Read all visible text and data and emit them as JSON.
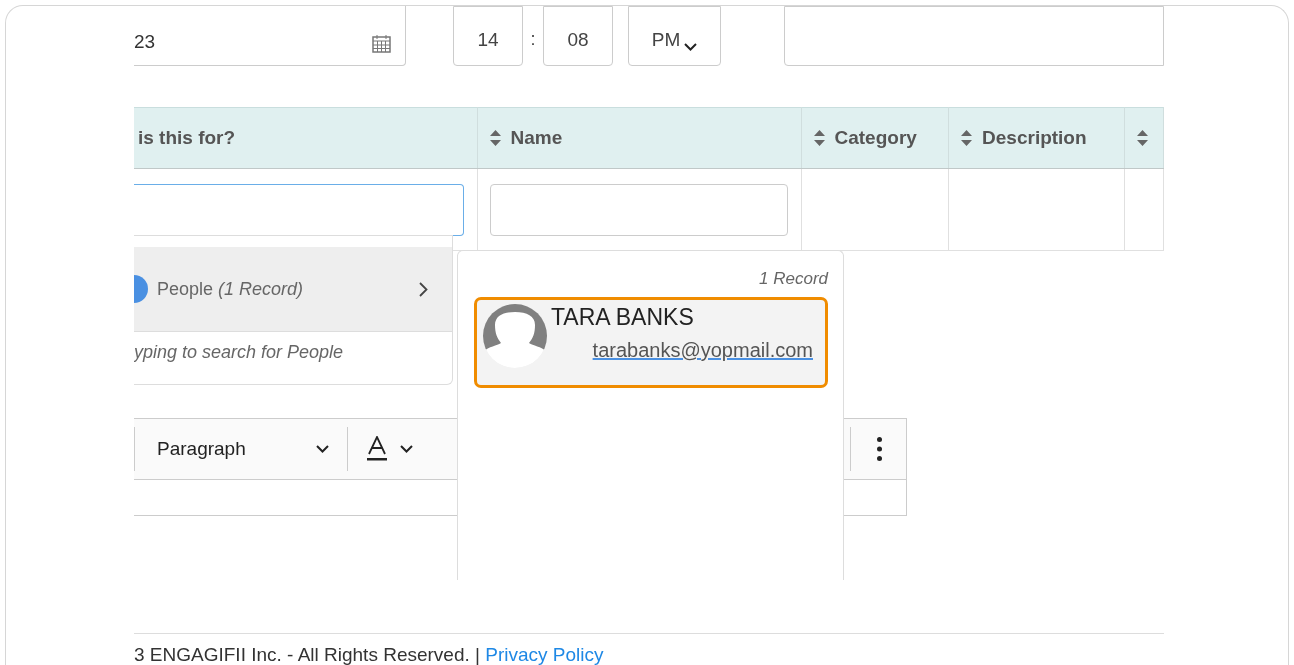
{
  "date_field": {
    "value": "23"
  },
  "time": {
    "hour": "14",
    "separator": ":",
    "minute": "08",
    "period": "PM"
  },
  "table": {
    "columns": [
      {
        "label": "is this for?",
        "sortable": false
      },
      {
        "label": "Name",
        "sortable": true
      },
      {
        "label": "Category",
        "sortable": true
      },
      {
        "label": "Description",
        "sortable": true
      },
      {
        "sortable": true
      }
    ]
  },
  "recipient_dropdown": {
    "groups": [
      {
        "label": "People *(1 Record)*",
        "selected": true
      }
    ],
    "hint": "yping to search for People"
  },
  "name_dropdown": {
    "count": "1  Record",
    "results": [
      {
        "name": "TARA BANKS",
        "email": "tarabanks@yopmail.com",
        "selected": true
      }
    ]
  },
  "editor": {
    "block_format": "Paragraph"
  },
  "footer": {
    "copyright": "3 ENGAGIFII Inc. - All Rights Reserved. |",
    "link": "Privacy Policy"
  }
}
